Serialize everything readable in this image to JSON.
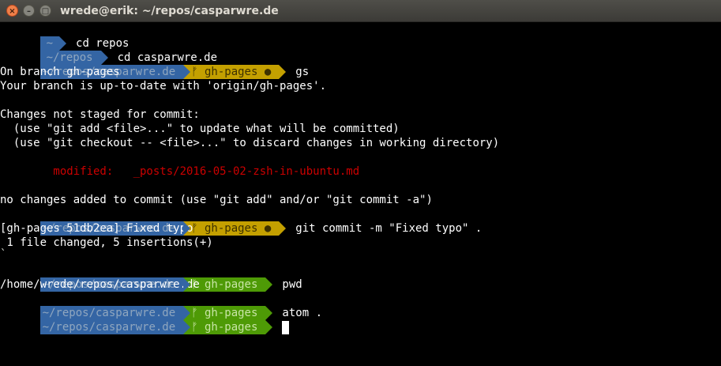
{
  "window": {
    "title": "wrede@erik: ~/repos/casparwre.de",
    "close_glyph": "×",
    "minimize_glyph": "–",
    "maximize_glyph": "□"
  },
  "prompts": {
    "home_dir": "~",
    "repos_dir": "~/repos",
    "project_dir": "~/repos/casparwre.de",
    "branch_dirty": "ᚠ gh-pages ●",
    "branch_clean": "ᚠ gh-pages",
    "colors": {
      "dir": "#3465a4",
      "git_dirty": "#c4a000",
      "git_clean": "#4e9a06"
    }
  },
  "commands": {
    "c1": "cd repos",
    "c2": "cd casparwre.de",
    "c3": "gs",
    "c4": "git commit -m \"Fixed typo\" .",
    "c5": "pwd",
    "c6": "atom ."
  },
  "output": {
    "o1": "On branch gh-pages",
    "o2": "Your branch is up-to-date with 'origin/gh-pages'.",
    "o3": "Changes not staged for commit:",
    "o4": "  (use \"git add <file>...\" to update what will be committed)",
    "o5": "  (use \"git checkout -- <file>...\" to discard changes in working directory)",
    "o6": "        modified:   _posts/2016-05-02-zsh-in-ubuntu.md",
    "o7": "no changes added to commit (use \"git add\" and/or \"git commit -a\")",
    "o8": "[gh-pages 51db2ea] Fixed typo",
    "o9": " 1 file changed, 5 insertions(+)",
    "o10": "`",
    "o11": "/home/wrede/repos/casparwre.de"
  }
}
